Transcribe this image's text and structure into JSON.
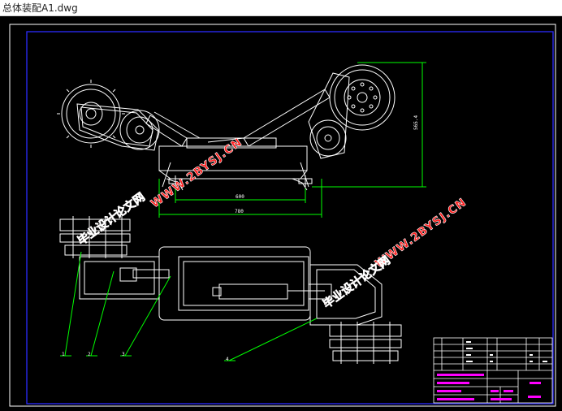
{
  "window": {
    "title": "总体装配A1.dwg"
  },
  "drawing": {
    "dim_horizontal_inner": "600",
    "dim_horizontal_outer": "780",
    "dim_vertical": "565.4",
    "part_labels": [
      "1",
      "2",
      "3",
      "4"
    ]
  },
  "watermark": {
    "text_site": "WWW.2BYSJ.CN",
    "text_cn": "毕业设计论文网"
  },
  "colors": {
    "background": "#000000",
    "linework": "#ffffff",
    "border": "#2b2bff",
    "dimension": "#00ff00",
    "leader": "#00ff00",
    "watermark_fill": "#ff1f1f",
    "watermark_stroke": "#ffffff",
    "titleblock_accent": "#ff00ff"
  }
}
